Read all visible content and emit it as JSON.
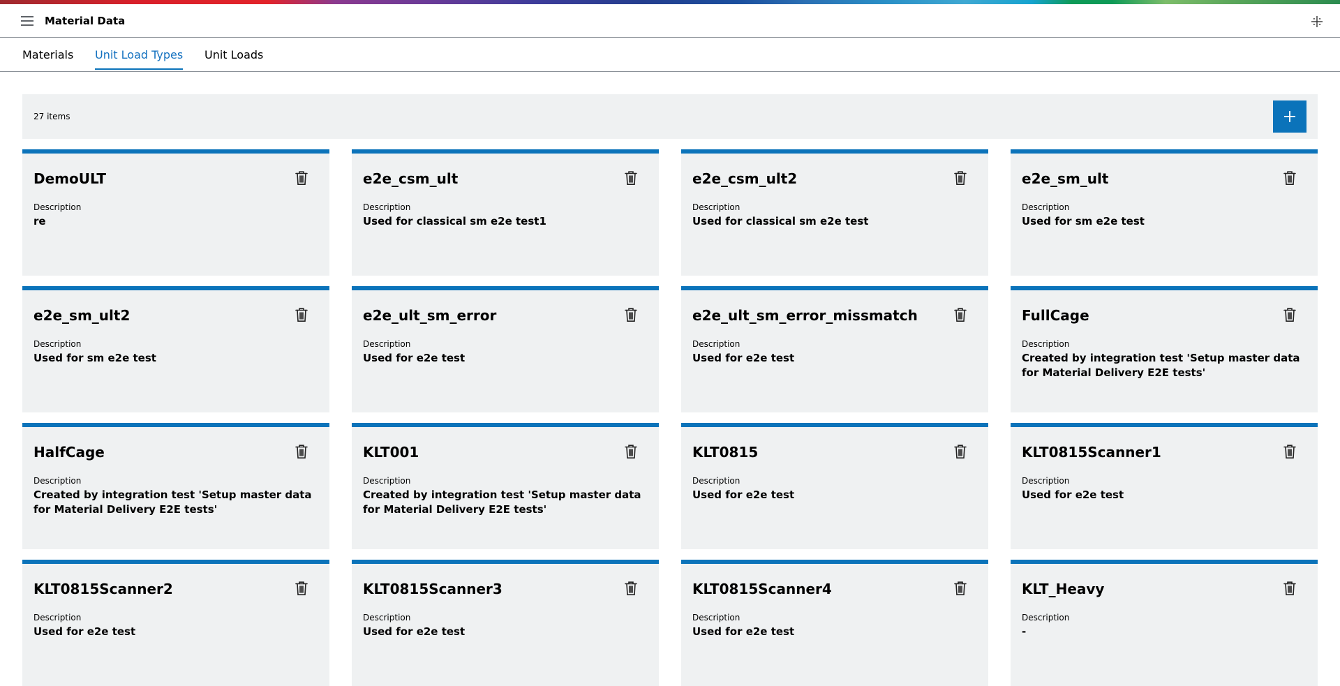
{
  "header": {
    "title": "Material Data",
    "menu_icon": "hamburger-menu-icon",
    "corner_icon": "collapse-icon"
  },
  "tabs": [
    {
      "label": "Materials",
      "active": false
    },
    {
      "label": "Unit Load Types",
      "active": true
    },
    {
      "label": "Unit Loads",
      "active": false
    }
  ],
  "toolbar": {
    "item_count": "27 items",
    "add_icon": "plus-icon"
  },
  "cards": [
    {
      "title": "DemoULT",
      "description_label": "Description",
      "description": "re"
    },
    {
      "title": "e2e_csm_ult",
      "description_label": "Description",
      "description": "Used for classical sm e2e test1"
    },
    {
      "title": "e2e_csm_ult2",
      "description_label": "Description",
      "description": "Used for classical sm e2e test"
    },
    {
      "title": "e2e_sm_ult",
      "description_label": "Description",
      "description": "Used for sm e2e test"
    },
    {
      "title": "e2e_sm_ult2",
      "description_label": "Description",
      "description": "Used for sm e2e test"
    },
    {
      "title": "e2e_ult_sm_error",
      "description_label": "Description",
      "description": "Used for e2e test"
    },
    {
      "title": "e2e_ult_sm_error_missmatch",
      "description_label": "Description",
      "description": "Used for e2e test"
    },
    {
      "title": "FullCage",
      "description_label": "Description",
      "description": "Created by integration test 'Setup master data for Material Delivery E2E tests'"
    },
    {
      "title": "HalfCage",
      "description_label": "Description",
      "description": "Created by integration test 'Setup master data for Material Delivery E2E tests'"
    },
    {
      "title": "KLT001",
      "description_label": "Description",
      "description": "Created by integration test 'Setup master data for Material Delivery E2E tests'"
    },
    {
      "title": "KLT0815",
      "description_label": "Description",
      "description": "Used for e2e test"
    },
    {
      "title": "KLT0815Scanner1",
      "description_label": "Description",
      "description": "Used for e2e test"
    },
    {
      "title": "KLT0815Scanner2",
      "description_label": "Description",
      "description": "Used for e2e test"
    },
    {
      "title": "KLT0815Scanner3",
      "description_label": "Description",
      "description": "Used for e2e test"
    },
    {
      "title": "KLT0815Scanner4",
      "description_label": "Description",
      "description": "Used for e2e test"
    },
    {
      "title": "KLT_Heavy",
      "description_label": "Description",
      "description": "-"
    }
  ],
  "colors": {
    "accent": "#0b73ba",
    "card_background": "#eff1f2"
  }
}
